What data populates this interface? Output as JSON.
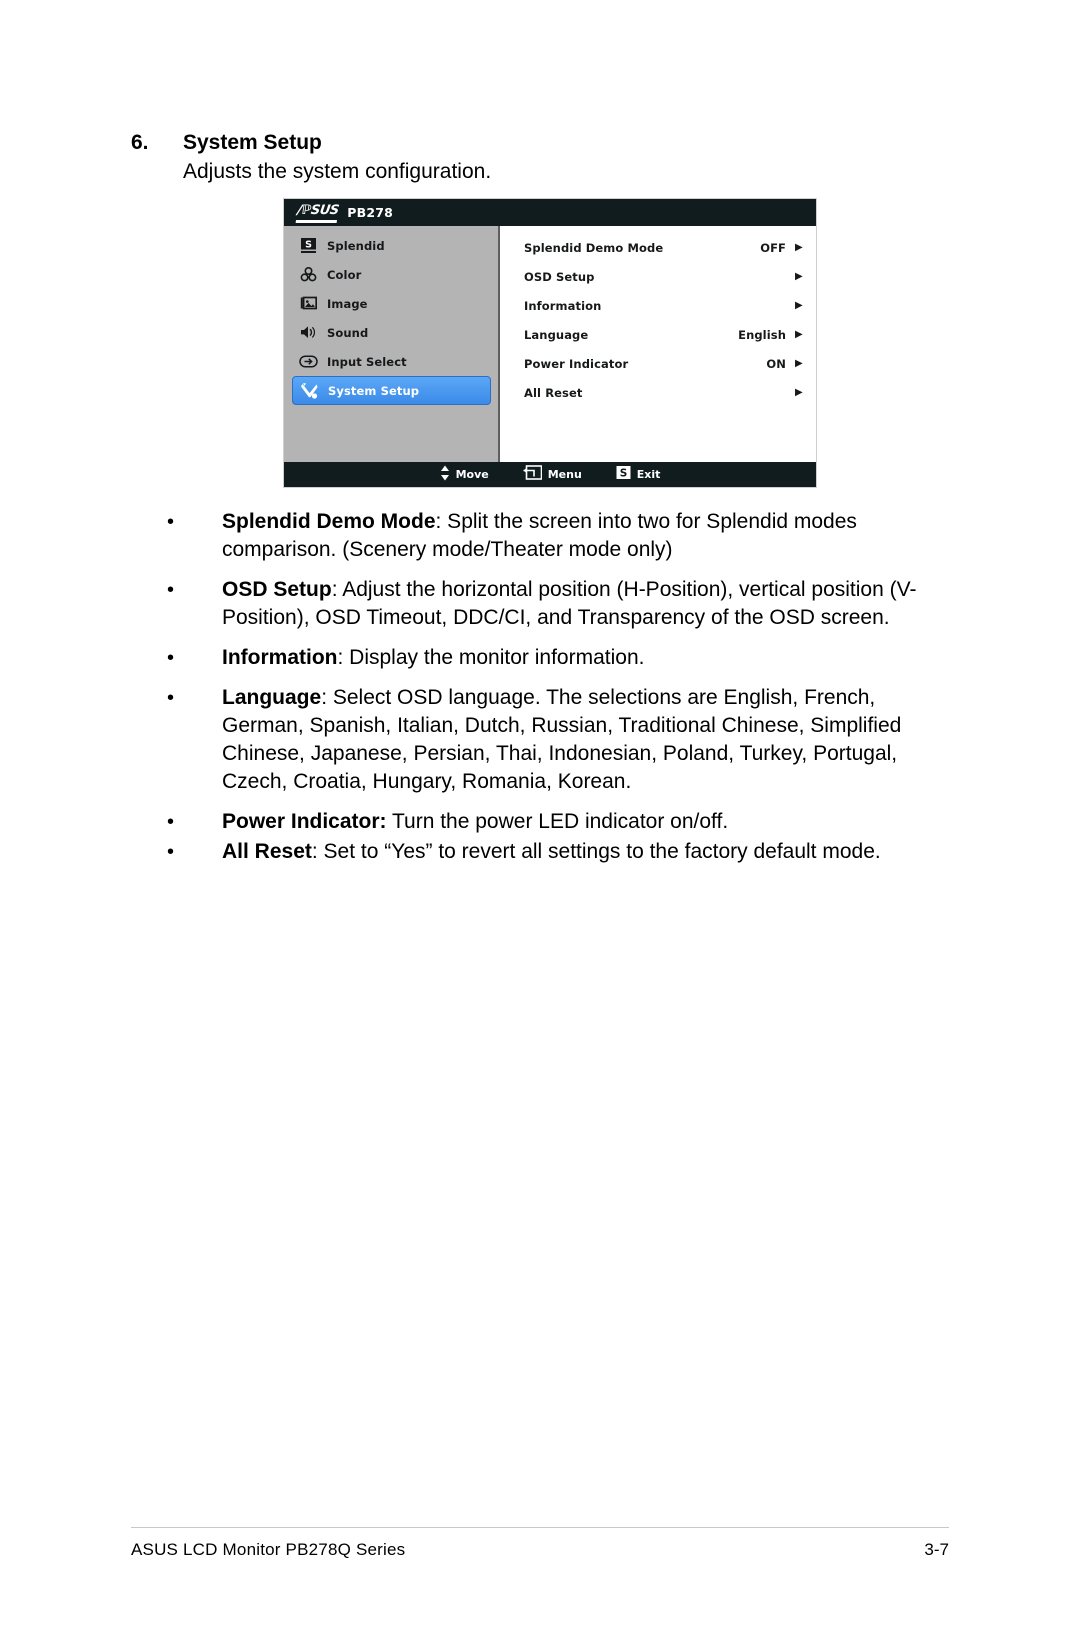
{
  "section": {
    "number": "6.",
    "title": "System Setup",
    "subtitle": "Adjusts the system configuration."
  },
  "osd": {
    "brand": "/iSUS",
    "model": "PB278",
    "sidebar": [
      {
        "label": "Splendid",
        "icon": "splendid-icon",
        "selected": false
      },
      {
        "label": "Color",
        "icon": "color-icon",
        "selected": false
      },
      {
        "label": "Image",
        "icon": "image-icon",
        "selected": false
      },
      {
        "label": "Sound",
        "icon": "sound-icon",
        "selected": false
      },
      {
        "label": "Input Select",
        "icon": "input-select-icon",
        "selected": false
      },
      {
        "label": "System Setup",
        "icon": "system-setup-icon",
        "selected": true
      }
    ],
    "items": [
      {
        "label": "Splendid Demo Mode",
        "value": "OFF",
        "arrow": "▶"
      },
      {
        "label": "OSD Setup",
        "value": "",
        "arrow": "▶"
      },
      {
        "label": "Information",
        "value": "",
        "arrow": "▶"
      },
      {
        "label": "Language",
        "value": "English",
        "arrow": "▶"
      },
      {
        "label": "Power Indicator",
        "value": "ON",
        "arrow": "▶"
      },
      {
        "label": "All Reset",
        "value": "",
        "arrow": "▶"
      }
    ],
    "footer": [
      {
        "label": "Move",
        "icon": "up-down-arrows-icon"
      },
      {
        "label": "Menu",
        "icon": "menu-enter-icon"
      },
      {
        "label": "Exit",
        "icon": "splendid-s-icon"
      }
    ],
    "colors": {
      "header_bg": "#111c1e",
      "sidebar_bg": "#b4b4b4",
      "selected_bg": "#4a96f0",
      "panel_bg": "#ffffff"
    }
  },
  "bullets": [
    {
      "bold": "Splendid Demo Mode",
      "rest": ": Split the screen into two for Splendid modes comparison. (Scenery mode/Theater mode only)"
    },
    {
      "bold": "OSD Setup",
      "rest": ": Adjust the horizontal position (H-Position), vertical position (V-Position), OSD Timeout, DDC/CI, and Transparency of the OSD screen."
    },
    {
      "bold": "Information",
      "rest": ": Display the monitor information."
    },
    {
      "bold": "Language",
      "rest": ": Select OSD language. The selections are English, French, German, Spanish, Italian, Dutch, Russian, Traditional Chinese, Simplified Chinese, Japanese, Persian, Thai, Indonesian, Poland, Turkey, Portugal, Czech, Croatia, Hungary, Romania, Korean."
    },
    {
      "bold": "Power Indicator:",
      "rest": " Turn the power LED indicator on/off."
    },
    {
      "bold": "All Reset",
      "rest": ": Set to “Yes” to revert all settings to the factory default mode."
    }
  ],
  "bullet_marker": "•",
  "page_footer": {
    "left": "ASUS LCD Monitor PB278Q Series",
    "right": "3-7"
  }
}
